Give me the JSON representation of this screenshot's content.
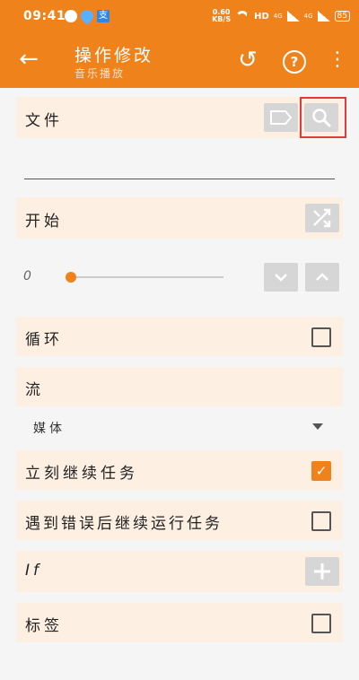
{
  "status_bar": {
    "time": "09:41",
    "speed": "0.60",
    "speed_unit": "KB/S",
    "hd": "HD",
    "net1": "4G",
    "net2": "4G",
    "battery": "85"
  },
  "app_bar": {
    "title": "操作修改",
    "subtitle": "音乐播放",
    "accent_color": "#f0821c"
  },
  "rows": {
    "file_label": "文件",
    "start_label": "开始",
    "slider_value": "0",
    "loop_label": "循环",
    "stream_label": "流",
    "stream_value": "媒体",
    "continue_label": "立刻继续任务",
    "continue_checked": true,
    "error_continue_label": "遇到错误后继续运行任务",
    "error_continue_checked": false,
    "if_label": "If",
    "tag_label": "标签",
    "tag_checked": false,
    "loop_checked": false
  },
  "icons": {
    "back": "arrow-left-icon",
    "reset": "reset-icon",
    "help": "help-icon",
    "more": "more-vert-icon",
    "label_tag": "label-tag-icon",
    "search": "search-icon",
    "shuffle": "shuffle-icon",
    "down": "chevron-down-icon",
    "up": "chevron-up-icon",
    "add": "plus-icon"
  }
}
